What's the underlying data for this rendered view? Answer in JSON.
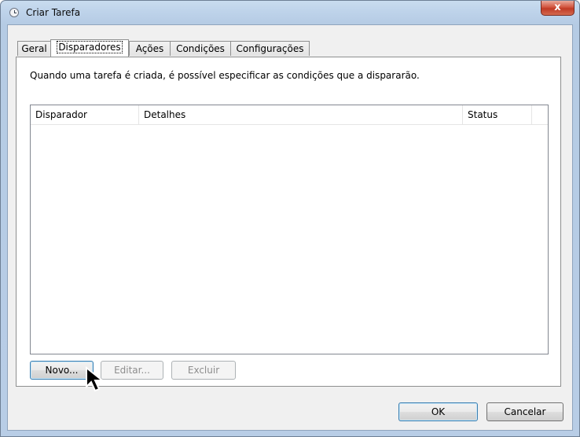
{
  "window": {
    "title": "Criar Tarefa",
    "close_label": "x"
  },
  "tabs": [
    {
      "label": "Geral"
    },
    {
      "label": "Disparadores"
    },
    {
      "label": "Ações"
    },
    {
      "label": "Condições"
    },
    {
      "label": "Configurações"
    }
  ],
  "active_tab": "Disparadores",
  "panel": {
    "description": "Quando uma tarefa é criada, é possível especificar as condições que a dispararão.",
    "columns": [
      {
        "label": "Disparador"
      },
      {
        "label": "Detalhes"
      },
      {
        "label": "Status"
      }
    ],
    "rows": [],
    "buttons": {
      "new_label": "Novo...",
      "edit_label": "Editar...",
      "delete_label": "Excluir"
    }
  },
  "footer": {
    "ok_label": "OK",
    "cancel_label": "Cancelar"
  },
  "icons": {
    "title_icon": "clock-icon",
    "cursor": "mouse-pointer-icon"
  },
  "colors": {
    "frame": "#bed3ea",
    "close_button": "#c03a25",
    "dialog_bg": "#f0f0f0",
    "focus_border": "#3c7fb1"
  }
}
